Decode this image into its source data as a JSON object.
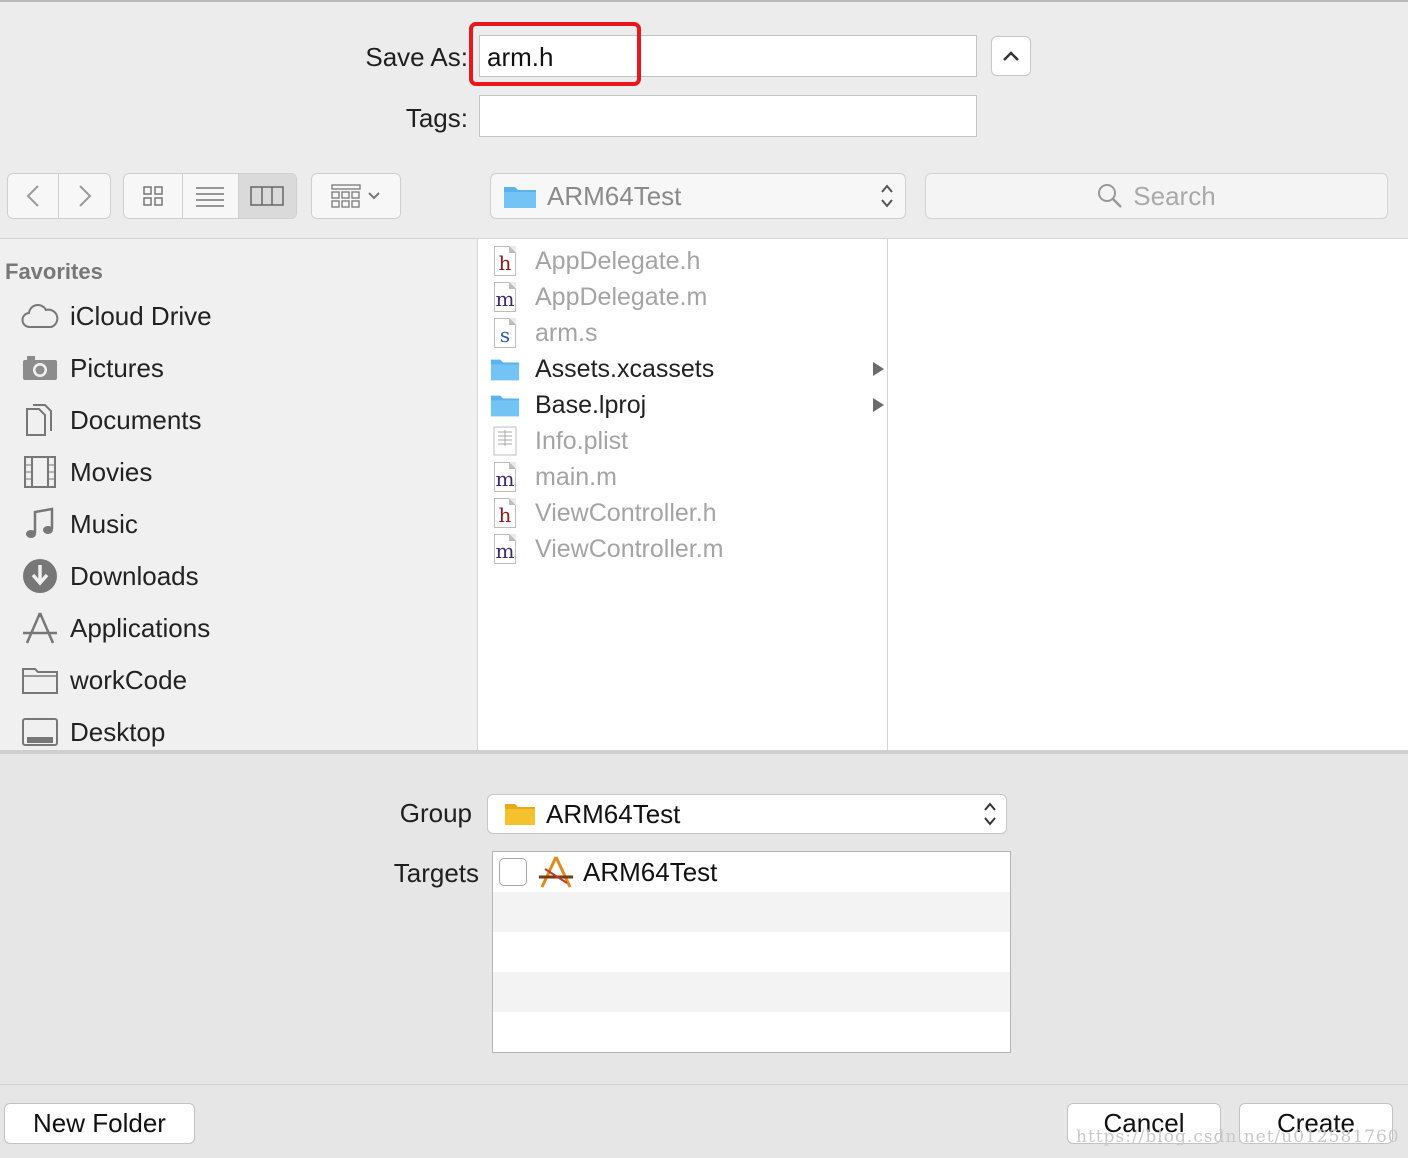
{
  "save_as": {
    "label": "Save As:",
    "value": "arm.h"
  },
  "tags": {
    "label": "Tags:",
    "value": ""
  },
  "toolbar": {
    "location": "ARM64Test",
    "search_placeholder": "Search"
  },
  "sidebar": {
    "heading": "Favorites",
    "items": [
      {
        "label": "iCloud Drive",
        "icon": "cloud-icon"
      },
      {
        "label": "Pictures",
        "icon": "camera-icon"
      },
      {
        "label": "Documents",
        "icon": "documents-icon"
      },
      {
        "label": "Movies",
        "icon": "film-icon"
      },
      {
        "label": "Music",
        "icon": "music-note-icon"
      },
      {
        "label": "Downloads",
        "icon": "download-icon"
      },
      {
        "label": "Applications",
        "icon": "applications-icon"
      },
      {
        "label": "workCode",
        "icon": "folder-icon"
      },
      {
        "label": "Desktop",
        "icon": "desktop-icon"
      }
    ]
  },
  "files": [
    {
      "name": "AppDelegate.h",
      "glyph": "h",
      "enabled": false
    },
    {
      "name": "AppDelegate.m",
      "glyph": "m",
      "enabled": false
    },
    {
      "name": "arm.s",
      "glyph": "s",
      "enabled": false
    },
    {
      "name": "Assets.xcassets",
      "glyph": "",
      "enabled": true
    },
    {
      "name": "Base.lproj",
      "glyph": "",
      "enabled": true
    },
    {
      "name": "Info.plist",
      "glyph": "",
      "enabled": false
    },
    {
      "name": "main.m",
      "glyph": "m",
      "enabled": false
    },
    {
      "name": "ViewController.h",
      "glyph": "h",
      "enabled": false
    },
    {
      "name": "ViewController.m",
      "glyph": "m",
      "enabled": false
    }
  ],
  "group": {
    "label": "Group",
    "value": "ARM64Test"
  },
  "targets": {
    "label": "Targets",
    "items": [
      {
        "name": "ARM64Test",
        "checked": false
      }
    ]
  },
  "buttons": {
    "new_folder": "New Folder",
    "cancel": "Cancel",
    "create": "Create"
  },
  "watermark": "https://blog.csdn.net/u012581760",
  "colors": {
    "highlight": "#e8171b",
    "folder_blue": "#5ab2ee",
    "folder_yellow": "#f5c22e",
    "h_glyph": "#8b1a1a",
    "m_glyph": "#3c2a6b",
    "s_glyph": "#2a5aa8"
  }
}
